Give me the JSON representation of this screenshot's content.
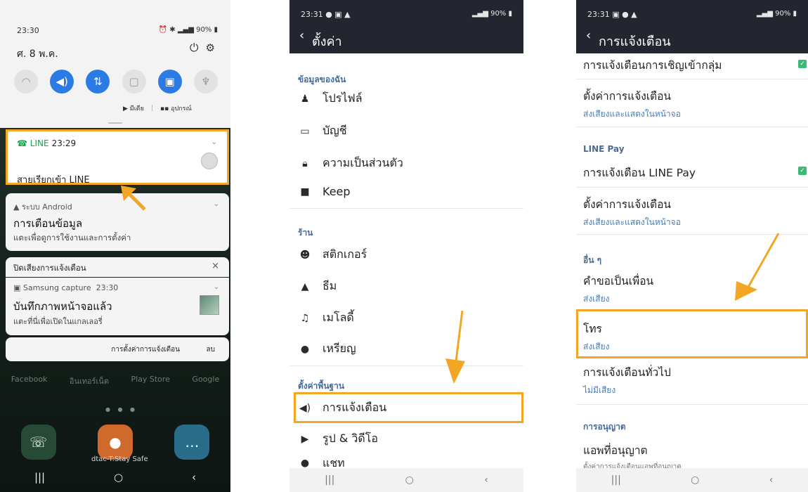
{
  "panel1": {
    "status_time": "23:30",
    "status_right": "90%",
    "date": "ศ. 8 พ.ค.",
    "quick_settings": [
      {
        "icon": "wifi-icon",
        "glyph": "◠",
        "on": false
      },
      {
        "icon": "sound-icon",
        "glyph": "🔊",
        "on": true
      },
      {
        "icon": "data-icon",
        "glyph": "⇅",
        "on": true
      },
      {
        "icon": "rotate-icon",
        "glyph": "▢",
        "on": false
      },
      {
        "icon": "battery-icon",
        "glyph": "▣",
        "on": true
      },
      {
        "icon": "flashlight-icon",
        "glyph": "♆",
        "on": false
      }
    ],
    "media_label": "มีเดีย",
    "devices_label": "อุปกรณ์",
    "line_card": {
      "app": "LINE",
      "time": "23:29",
      "text": "สายเรียกเข้า LINE"
    },
    "android_card": {
      "app": "ระบบ Android",
      "title": "การเตือนข้อมูล",
      "sub": "แตะเพื่อดูการใช้งานและการตั้งค่า"
    },
    "mute_card": {
      "text": "ปิดเสียงการแจ้งเตือน",
      "close": "×"
    },
    "capture_card": {
      "app": "Samsung capture",
      "time": "23:30",
      "title": "บันทึกภาพหน้าจอแล้ว",
      "sub": "แตะที่นี่เพื่อเปิดในแกลเลอรี่"
    },
    "settings_link": "การตั้งค่าการแจ้งเตือน",
    "clear_link": "ลบ",
    "home_apps": [
      "Facebook",
      "อินเทอร์เน็ต",
      "Play Store",
      "Google"
    ],
    "carrier": "dtac-T:Stay Safe",
    "nav": [
      "|||",
      "○",
      "‹"
    ]
  },
  "panel2": {
    "status_time": "23:31",
    "status_right": "90%",
    "title": "ตั้งค่า",
    "sections": {
      "mydata": "ข้อมูลของฉัน",
      "shop": "ร้าน",
      "basic": "ตั้งค่าพื้นฐาน"
    },
    "items": {
      "profile": "โปรไฟล์",
      "account": "บัญชี",
      "privacy": "ความเป็นส่วนตัว",
      "keep": "Keep",
      "sticker": "สติกเกอร์",
      "theme": "ธีม",
      "melody": "เมโลดี้",
      "coin": "เหรียญ",
      "notifications": "การแจ้งเตือน",
      "photo_video": "รูป & วิดีโอ",
      "chat": "แชท"
    },
    "nav": [
      "|||",
      "○",
      "‹"
    ]
  },
  "panel3": {
    "status_time": "23:31",
    "status_right": "90%",
    "title": "การแจ้งเตือน",
    "group_invite": "การแจ้งเตือนการเชิญเข้ากลุ่ม",
    "notif_settings1": {
      "title": "ตั้งค่าการแจ้งเตือน",
      "sub": "ส่งเสียงและแสดงในหน้าจอ"
    },
    "linepay_section": "LINE Pay",
    "linepay_notif": "การแจ้งเตือน LINE Pay",
    "notif_settings2": {
      "title": "ตั้งค่าการแจ้งเตือน",
      "sub": "ส่งเสียงและแสดงในหน้าจอ"
    },
    "other_section": "อื่น ๆ",
    "friend_request": {
      "title": "คำขอเป็นเพื่อน",
      "sub": "ส่งเสียง"
    },
    "call": {
      "title": "โทร",
      "sub": "ส่งเสียง"
    },
    "general": {
      "title": "การแจ้งเตือนทั่วไป",
      "sub": "ไม่มีเสียง"
    },
    "permission_section": "การอนุญาต",
    "allowed_apps": {
      "title": "แอพที่อนุญาต",
      "sub": "ตั้งค่าการแจ้งเตือนแอพที่อนุญาต"
    },
    "nav": [
      "|||",
      "○",
      "‹"
    ]
  },
  "colors": {
    "highlight": "#f2a623",
    "appbar": "#23262f",
    "section": "#4a6b96",
    "accent": "#2c7be5",
    "line_green": "#17a34a"
  }
}
